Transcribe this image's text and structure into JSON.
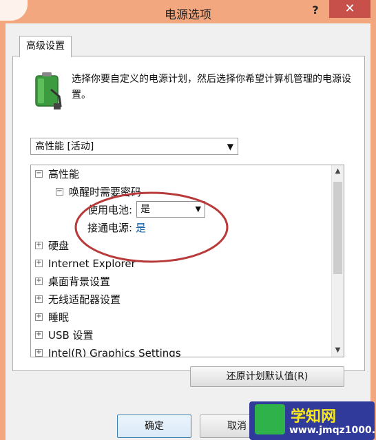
{
  "window": {
    "title": "电源选项",
    "help_label": "?",
    "close_label": "✕"
  },
  "tab": {
    "label": "高级设置"
  },
  "intro_text": "选择你要自定义的电源计划，然后选择你希望计算机管理的电源设置。",
  "plan_select": {
    "value": "高性能 [活动]"
  },
  "tree": {
    "root": "高性能",
    "wake_password": "唤醒时需要密码",
    "battery_label": "使用电池:",
    "battery_value": "是",
    "plugged_label": "接通电源:",
    "plugged_value": "是",
    "items": [
      "硬盘",
      "Internet Explorer",
      "桌面背景设置",
      "无线适配器设置",
      "睡眠",
      "USB 设置",
      "Intel(R) Graphics Settings"
    ]
  },
  "buttons": {
    "restore": "还原计划默认值(R)",
    "ok": "确定",
    "cancel": "取消"
  },
  "watermark": {
    "line1": "学知网",
    "line2": "www.jmqz1000.com"
  },
  "colors": {
    "accent": "#f3a77e",
    "close": "#c7504a",
    "highlight_circle": "#b83a3a",
    "link": "#1a5fa7"
  },
  "icons": [
    "power-battery-icon",
    "chevron-down-icon",
    "collapse-icon",
    "expand-icon",
    "scroll-up-icon",
    "scroll-down-icon"
  ]
}
